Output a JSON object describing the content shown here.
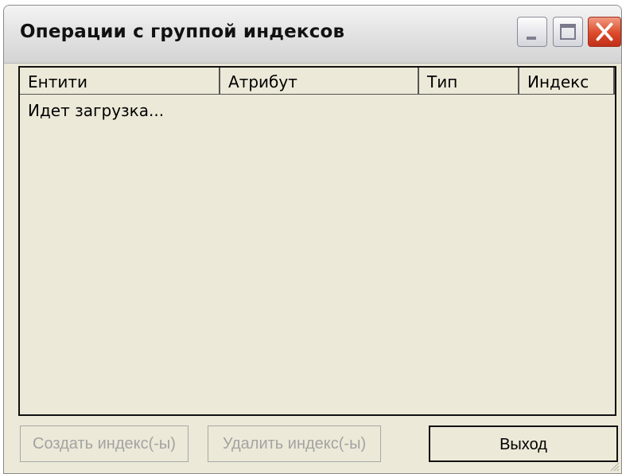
{
  "window": {
    "title": "Операции с группой индексов"
  },
  "titlebar_buttons": {
    "minimize_icon": "minimize-icon",
    "maximize_icon": "maximize-icon",
    "close_icon": "close-icon"
  },
  "list": {
    "columns": [
      "Ентити",
      "Атрибут",
      "Тип",
      "Индекс"
    ],
    "status_text": "Идет загрузка..."
  },
  "buttons": {
    "create_label": "Создать индекс(-ы)",
    "delete_label": "Удалить индекс(-ы)",
    "exit_label": "Выход"
  },
  "colors": {
    "window_bg": "#ece9d8",
    "close_red": "#dc4a2a",
    "disabled_text": "#a3a3a3"
  }
}
